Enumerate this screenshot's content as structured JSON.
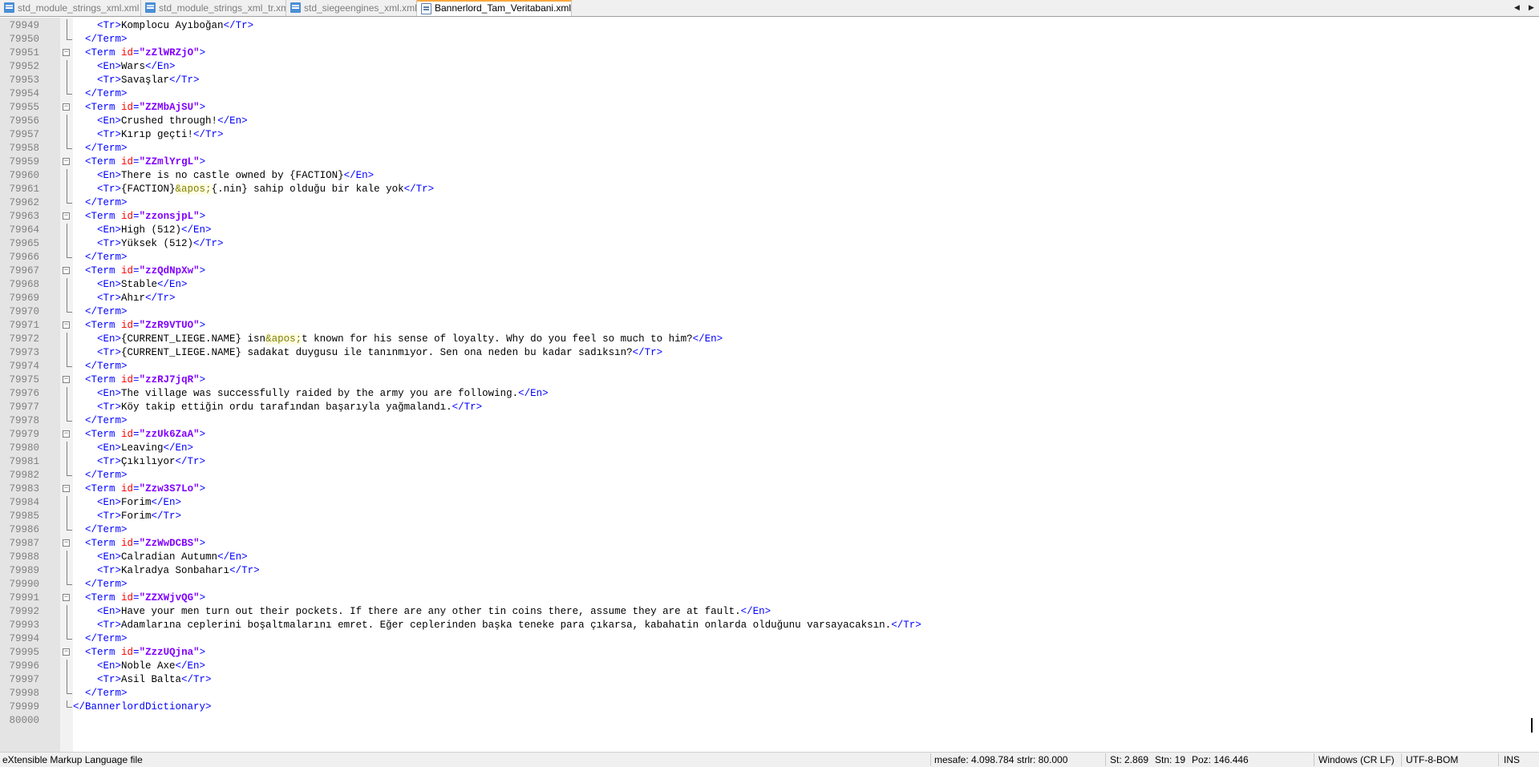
{
  "tabs": [
    {
      "label": "std_module_strings_xml.xml",
      "active": false
    },
    {
      "label": "std_module_strings_xml_tr.xml",
      "active": false
    },
    {
      "label": "std_siegeengines_xml.xml",
      "active": false
    },
    {
      "label": "Bannerlord_Tam_Veritabani.xml",
      "active": true
    }
  ],
  "editor": {
    "lines": [
      {
        "n": "79949",
        "fold": "line",
        "segs": [
          [
            "tx",
            "    "
          ],
          [
            "tg",
            "<Tr>"
          ],
          [
            "tx",
            "Komplocu Ayıboğan"
          ],
          [
            "tg",
            "</Tr>"
          ]
        ]
      },
      {
        "n": "79950",
        "fold": "end",
        "segs": [
          [
            "tx",
            "  "
          ],
          [
            "tg",
            "</Term>"
          ]
        ]
      },
      {
        "n": "79951",
        "fold": "box",
        "segs": [
          [
            "tx",
            "  "
          ],
          [
            "tg",
            "<Term "
          ],
          [
            "at",
            "id"
          ],
          [
            "tg",
            "="
          ],
          [
            "av",
            "\"zZlWRZjO\""
          ],
          [
            "tg",
            ">"
          ]
        ]
      },
      {
        "n": "79952",
        "fold": "line",
        "segs": [
          [
            "tx",
            "    "
          ],
          [
            "tg",
            "<En>"
          ],
          [
            "tx",
            "Wars"
          ],
          [
            "tg",
            "</En>"
          ]
        ]
      },
      {
        "n": "79953",
        "fold": "line",
        "segs": [
          [
            "tx",
            "    "
          ],
          [
            "tg",
            "<Tr>"
          ],
          [
            "tx",
            "Savaşlar"
          ],
          [
            "tg",
            "</Tr>"
          ]
        ]
      },
      {
        "n": "79954",
        "fold": "end",
        "segs": [
          [
            "tx",
            "  "
          ],
          [
            "tg",
            "</Term>"
          ]
        ]
      },
      {
        "n": "79955",
        "fold": "box",
        "segs": [
          [
            "tx",
            "  "
          ],
          [
            "tg",
            "<Term "
          ],
          [
            "at",
            "id"
          ],
          [
            "tg",
            "="
          ],
          [
            "av",
            "\"ZZMbAjSU\""
          ],
          [
            "tg",
            ">"
          ]
        ]
      },
      {
        "n": "79956",
        "fold": "line",
        "segs": [
          [
            "tx",
            "    "
          ],
          [
            "tg",
            "<En>"
          ],
          [
            "tx",
            "Crushed through!"
          ],
          [
            "tg",
            "</En>"
          ]
        ]
      },
      {
        "n": "79957",
        "fold": "line",
        "segs": [
          [
            "tx",
            "    "
          ],
          [
            "tg",
            "<Tr>"
          ],
          [
            "tx",
            "Kırıp geçti!"
          ],
          [
            "tg",
            "</Tr>"
          ]
        ]
      },
      {
        "n": "79958",
        "fold": "end",
        "segs": [
          [
            "tx",
            "  "
          ],
          [
            "tg",
            "</Term>"
          ]
        ]
      },
      {
        "n": "79959",
        "fold": "box",
        "segs": [
          [
            "tx",
            "  "
          ],
          [
            "tg",
            "<Term "
          ],
          [
            "at",
            "id"
          ],
          [
            "tg",
            "="
          ],
          [
            "av",
            "\"ZZmlYrgL\""
          ],
          [
            "tg",
            ">"
          ]
        ]
      },
      {
        "n": "79960",
        "fold": "line",
        "segs": [
          [
            "tx",
            "    "
          ],
          [
            "tg",
            "<En>"
          ],
          [
            "tx",
            "There is no castle owned by {FACTION}"
          ],
          [
            "tg",
            "</En>"
          ]
        ]
      },
      {
        "n": "79961",
        "fold": "line",
        "segs": [
          [
            "tx",
            "    "
          ],
          [
            "tg",
            "<Tr>"
          ],
          [
            "tx",
            "{FACTION}"
          ],
          [
            "en",
            "&apos;"
          ],
          [
            "tx",
            "{.nin} sahip olduğu bir kale yok"
          ],
          [
            "tg",
            "</Tr>"
          ]
        ]
      },
      {
        "n": "79962",
        "fold": "end",
        "segs": [
          [
            "tx",
            "  "
          ],
          [
            "tg",
            "</Term>"
          ]
        ]
      },
      {
        "n": "79963",
        "fold": "box",
        "segs": [
          [
            "tx",
            "  "
          ],
          [
            "tg",
            "<Term "
          ],
          [
            "at",
            "id"
          ],
          [
            "tg",
            "="
          ],
          [
            "av",
            "\"zzonsjpL\""
          ],
          [
            "tg",
            ">"
          ]
        ]
      },
      {
        "n": "79964",
        "fold": "line",
        "segs": [
          [
            "tx",
            "    "
          ],
          [
            "tg",
            "<En>"
          ],
          [
            "tx",
            "High (512)"
          ],
          [
            "tg",
            "</En>"
          ]
        ]
      },
      {
        "n": "79965",
        "fold": "line",
        "segs": [
          [
            "tx",
            "    "
          ],
          [
            "tg",
            "<Tr>"
          ],
          [
            "tx",
            "Yüksek (512)"
          ],
          [
            "tg",
            "</Tr>"
          ]
        ]
      },
      {
        "n": "79966",
        "fold": "end",
        "segs": [
          [
            "tx",
            "  "
          ],
          [
            "tg",
            "</Term>"
          ]
        ]
      },
      {
        "n": "79967",
        "fold": "box",
        "segs": [
          [
            "tx",
            "  "
          ],
          [
            "tg",
            "<Term "
          ],
          [
            "at",
            "id"
          ],
          [
            "tg",
            "="
          ],
          [
            "av",
            "\"zzQdNpXw\""
          ],
          [
            "tg",
            ">"
          ]
        ]
      },
      {
        "n": "79968",
        "fold": "line",
        "segs": [
          [
            "tx",
            "    "
          ],
          [
            "tg",
            "<En>"
          ],
          [
            "tx",
            "Stable"
          ],
          [
            "tg",
            "</En>"
          ]
        ]
      },
      {
        "n": "79969",
        "fold": "line",
        "segs": [
          [
            "tx",
            "    "
          ],
          [
            "tg",
            "<Tr>"
          ],
          [
            "tx",
            "Ahır"
          ],
          [
            "tg",
            "</Tr>"
          ]
        ]
      },
      {
        "n": "79970",
        "fold": "end",
        "segs": [
          [
            "tx",
            "  "
          ],
          [
            "tg",
            "</Term>"
          ]
        ]
      },
      {
        "n": "79971",
        "fold": "box",
        "segs": [
          [
            "tx",
            "  "
          ],
          [
            "tg",
            "<Term "
          ],
          [
            "at",
            "id"
          ],
          [
            "tg",
            "="
          ],
          [
            "av",
            "\"ZzR9VTUO\""
          ],
          [
            "tg",
            ">"
          ]
        ]
      },
      {
        "n": "79972",
        "fold": "line",
        "segs": [
          [
            "tx",
            "    "
          ],
          [
            "tg",
            "<En>"
          ],
          [
            "tx",
            "{CURRENT_LIEGE.NAME} isn"
          ],
          [
            "en",
            "&apos;"
          ],
          [
            "tx",
            "t known for his sense of loyalty. Why do you feel so much to him?"
          ],
          [
            "tg",
            "</En>"
          ]
        ]
      },
      {
        "n": "79973",
        "fold": "line",
        "segs": [
          [
            "tx",
            "    "
          ],
          [
            "tg",
            "<Tr>"
          ],
          [
            "tx",
            "{CURRENT_LIEGE.NAME} sadakat duygusu ile tanınmıyor. Sen ona neden bu kadar sadıksın?"
          ],
          [
            "tg",
            "</Tr>"
          ]
        ]
      },
      {
        "n": "79974",
        "fold": "end",
        "segs": [
          [
            "tx",
            "  "
          ],
          [
            "tg",
            "</Term>"
          ]
        ]
      },
      {
        "n": "79975",
        "fold": "box",
        "segs": [
          [
            "tx",
            "  "
          ],
          [
            "tg",
            "<Term "
          ],
          [
            "at",
            "id"
          ],
          [
            "tg",
            "="
          ],
          [
            "av",
            "\"zzRJ7jqR\""
          ],
          [
            "tg",
            ">"
          ]
        ]
      },
      {
        "n": "79976",
        "fold": "line",
        "segs": [
          [
            "tx",
            "    "
          ],
          [
            "tg",
            "<En>"
          ],
          [
            "tx",
            "The village was successfully raided by the army you are following."
          ],
          [
            "tg",
            "</En>"
          ]
        ]
      },
      {
        "n": "79977",
        "fold": "line",
        "segs": [
          [
            "tx",
            "    "
          ],
          [
            "tg",
            "<Tr>"
          ],
          [
            "tx",
            "Köy takip ettiğin ordu tarafından başarıyla yağmalandı."
          ],
          [
            "tg",
            "</Tr>"
          ]
        ]
      },
      {
        "n": "79978",
        "fold": "end",
        "segs": [
          [
            "tx",
            "  "
          ],
          [
            "tg",
            "</Term>"
          ]
        ]
      },
      {
        "n": "79979",
        "fold": "box",
        "segs": [
          [
            "tx",
            "  "
          ],
          [
            "tg",
            "<Term "
          ],
          [
            "at",
            "id"
          ],
          [
            "tg",
            "="
          ],
          [
            "av",
            "\"zzUk6ZaA\""
          ],
          [
            "tg",
            ">"
          ]
        ]
      },
      {
        "n": "79980",
        "fold": "line",
        "segs": [
          [
            "tx",
            "    "
          ],
          [
            "tg",
            "<En>"
          ],
          [
            "tx",
            "Leaving"
          ],
          [
            "tg",
            "</En>"
          ]
        ]
      },
      {
        "n": "79981",
        "fold": "line",
        "segs": [
          [
            "tx",
            "    "
          ],
          [
            "tg",
            "<Tr>"
          ],
          [
            "tx",
            "Çıkılıyor"
          ],
          [
            "tg",
            "</Tr>"
          ]
        ]
      },
      {
        "n": "79982",
        "fold": "end",
        "segs": [
          [
            "tx",
            "  "
          ],
          [
            "tg",
            "</Term>"
          ]
        ]
      },
      {
        "n": "79983",
        "fold": "box",
        "segs": [
          [
            "tx",
            "  "
          ],
          [
            "tg",
            "<Term "
          ],
          [
            "at",
            "id"
          ],
          [
            "tg",
            "="
          ],
          [
            "av",
            "\"Zzw3S7Lo\""
          ],
          [
            "tg",
            ">"
          ]
        ]
      },
      {
        "n": "79984",
        "fold": "line",
        "segs": [
          [
            "tx",
            "    "
          ],
          [
            "tg",
            "<En>"
          ],
          [
            "tx",
            "Forim"
          ],
          [
            "tg",
            "</En>"
          ]
        ]
      },
      {
        "n": "79985",
        "fold": "line",
        "segs": [
          [
            "tx",
            "    "
          ],
          [
            "tg",
            "<Tr>"
          ],
          [
            "tx",
            "Forim"
          ],
          [
            "tg",
            "</Tr>"
          ]
        ]
      },
      {
        "n": "79986",
        "fold": "end",
        "segs": [
          [
            "tx",
            "  "
          ],
          [
            "tg",
            "</Term>"
          ]
        ]
      },
      {
        "n": "79987",
        "fold": "box",
        "segs": [
          [
            "tx",
            "  "
          ],
          [
            "tg",
            "<Term "
          ],
          [
            "at",
            "id"
          ],
          [
            "tg",
            "="
          ],
          [
            "av",
            "\"ZzWwDCBS\""
          ],
          [
            "tg",
            ">"
          ]
        ]
      },
      {
        "n": "79988",
        "fold": "line",
        "segs": [
          [
            "tx",
            "    "
          ],
          [
            "tg",
            "<En>"
          ],
          [
            "tx",
            "Calradian Autumn"
          ],
          [
            "tg",
            "</En>"
          ]
        ]
      },
      {
        "n": "79989",
        "fold": "line",
        "segs": [
          [
            "tx",
            "    "
          ],
          [
            "tg",
            "<Tr>"
          ],
          [
            "tx",
            "Kalradya Sonbaharı"
          ],
          [
            "tg",
            "</Tr>"
          ]
        ]
      },
      {
        "n": "79990",
        "fold": "end",
        "segs": [
          [
            "tx",
            "  "
          ],
          [
            "tg",
            "</Term>"
          ]
        ]
      },
      {
        "n": "79991",
        "fold": "box",
        "segs": [
          [
            "tx",
            "  "
          ],
          [
            "tg",
            "<Term "
          ],
          [
            "at",
            "id"
          ],
          [
            "tg",
            "="
          ],
          [
            "av",
            "\"ZZXWjvQG\""
          ],
          [
            "tg",
            ">"
          ]
        ]
      },
      {
        "n": "79992",
        "fold": "line",
        "segs": [
          [
            "tx",
            "    "
          ],
          [
            "tg",
            "<En>"
          ],
          [
            "tx",
            "Have your men turn out their pockets. If there are any other tin coins there, assume they are at fault."
          ],
          [
            "tg",
            "</En>"
          ]
        ]
      },
      {
        "n": "79993",
        "fold": "line",
        "segs": [
          [
            "tx",
            "    "
          ],
          [
            "tg",
            "<Tr>"
          ],
          [
            "tx",
            "Adamlarına ceplerini boşaltmalarını emret. Eğer ceplerinden başka teneke para çıkarsa, kabahatin onlarda olduğunu varsayacaksın."
          ],
          [
            "tg",
            "</Tr>"
          ]
        ]
      },
      {
        "n": "79994",
        "fold": "end",
        "segs": [
          [
            "tx",
            "  "
          ],
          [
            "tg",
            "</Term>"
          ]
        ]
      },
      {
        "n": "79995",
        "fold": "box",
        "segs": [
          [
            "tx",
            "  "
          ],
          [
            "tg",
            "<Term "
          ],
          [
            "at",
            "id"
          ],
          [
            "tg",
            "="
          ],
          [
            "av",
            "\"ZzzUQjna\""
          ],
          [
            "tg",
            ">"
          ]
        ]
      },
      {
        "n": "79996",
        "fold": "line",
        "segs": [
          [
            "tx",
            "    "
          ],
          [
            "tg",
            "<En>"
          ],
          [
            "tx",
            "Noble Axe"
          ],
          [
            "tg",
            "</En>"
          ]
        ]
      },
      {
        "n": "79997",
        "fold": "line",
        "segs": [
          [
            "tx",
            "    "
          ],
          [
            "tg",
            "<Tr>"
          ],
          [
            "tx",
            "Asil Balta"
          ],
          [
            "tg",
            "</Tr>"
          ]
        ]
      },
      {
        "n": "79998",
        "fold": "end",
        "segs": [
          [
            "tx",
            "  "
          ],
          [
            "tg",
            "</Term>"
          ]
        ]
      },
      {
        "n": "79999",
        "fold": "end",
        "segs": [
          [
            "tg",
            "</BannerlordDictionary>"
          ]
        ]
      },
      {
        "n": "80000",
        "fold": "none",
        "segs": []
      }
    ]
  },
  "status": {
    "file_type": "eXtensible Markup Language file",
    "length": "mesafe: 4.098.784",
    "lines": "strlr: 80.000",
    "line_pos": "St: 2.869",
    "col": "Stn: 19",
    "pos": "Poz: 146.446",
    "eol": "Windows (CR LF)",
    "encoding": "UTF-8-BOM",
    "mode": "INS"
  },
  "colors": {
    "tag": "#0000ff",
    "attr": "#ff0000",
    "attr_value": "#8000ff",
    "entity": "#808000",
    "active_tab_accent": "#f9a83e",
    "close_button": "#e8474a"
  },
  "icons": {
    "file_tab": "xml-file-icon",
    "pin": "pin-icon",
    "close": "close-icon",
    "scroll_left": "chevron-left-icon",
    "scroll_right": "chevron-right-icon",
    "fold": "fold-minus-icon"
  }
}
